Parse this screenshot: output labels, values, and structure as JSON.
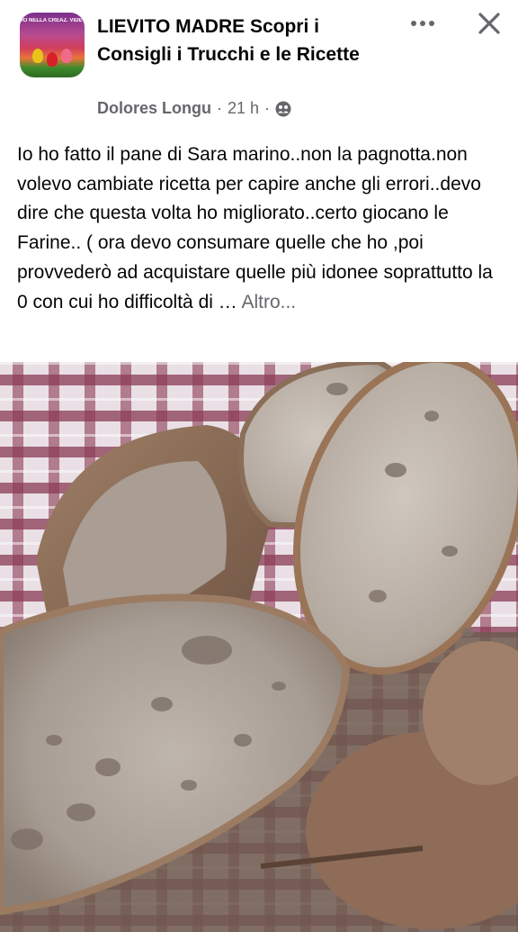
{
  "group": {
    "title": "LIEVITO MADRE Scopri i Consigli i Trucchi e le Ricette",
    "avatar_caption": "IO NELLA CREAZ. VIDEO CORSO ONLI"
  },
  "meta": {
    "author": "Dolores Longu",
    "separator": "·",
    "time": "21 h",
    "separator2": "·",
    "privacy_icon": "group-members-icon"
  },
  "actions": {
    "more_icon": "more-horizontal-icon",
    "close_icon": "close-icon"
  },
  "post": {
    "text": "Io ho fatto il pane di Sara marino..non la pagnotta.non volevo cambiate ricetta per capire anche gli errori..devo dire che questa volta ho migliorato..certo giocano le Farine.. ( ora devo consumare quelle che ho ,poi provvederò ad acquistare quelle più idonee soprattutto la 0 con cui ho difficoltà di … ",
    "see_more": "Altro..."
  },
  "photo": {
    "subject": "sliced-bread-loaves-photo"
  }
}
